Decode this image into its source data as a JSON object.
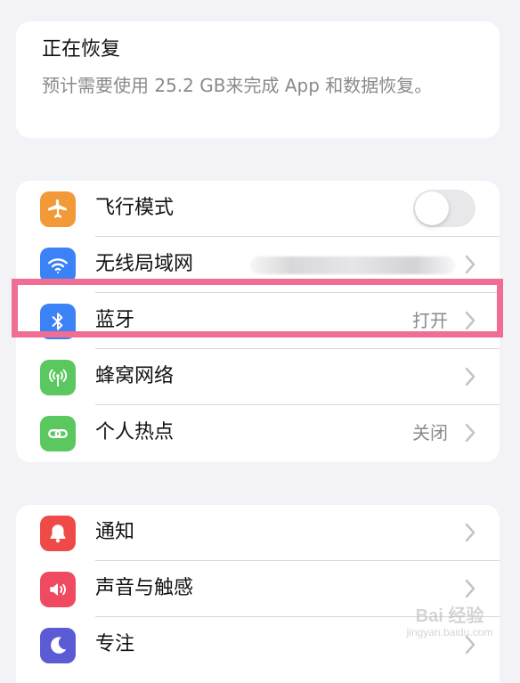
{
  "restore": {
    "title": "正在恢复",
    "description": "预计需要使用 25.2 GB来完成 App 和数据恢复。"
  },
  "group1": {
    "items": [
      {
        "label": "飞行模式",
        "type": "toggle",
        "toggle_on": false,
        "icon": "airplane-icon",
        "icon_bg": "#f29a38"
      },
      {
        "label": "无线局域网",
        "type": "link",
        "value_obscured": true,
        "icon": "wifi-icon",
        "icon_bg": "#3a82f6"
      },
      {
        "label": "蓝牙",
        "type": "link",
        "value": "打开",
        "icon": "bluetooth-icon",
        "icon_bg": "#3a82f6"
      },
      {
        "label": "蜂窝网络",
        "type": "link",
        "icon": "cellular-icon",
        "icon_bg": "#5ac85e"
      },
      {
        "label": "个人热点",
        "type": "link",
        "value": "关闭",
        "icon": "hotspot-icon",
        "icon_bg": "#5ac85e"
      }
    ]
  },
  "group2": {
    "items": [
      {
        "label": "通知",
        "icon": "notification-icon",
        "icon_bg": "#f04a48"
      },
      {
        "label": "声音与触感",
        "icon": "sound-icon",
        "icon_bg": "#ef4a60"
      },
      {
        "label": "专注",
        "icon": "moon-icon",
        "icon_bg": "#5b5bd6"
      }
    ]
  },
  "highlight_color": "#f06e94",
  "watermark": {
    "main": "Bai 经验",
    "sub": "jingyan.baidu.com"
  }
}
